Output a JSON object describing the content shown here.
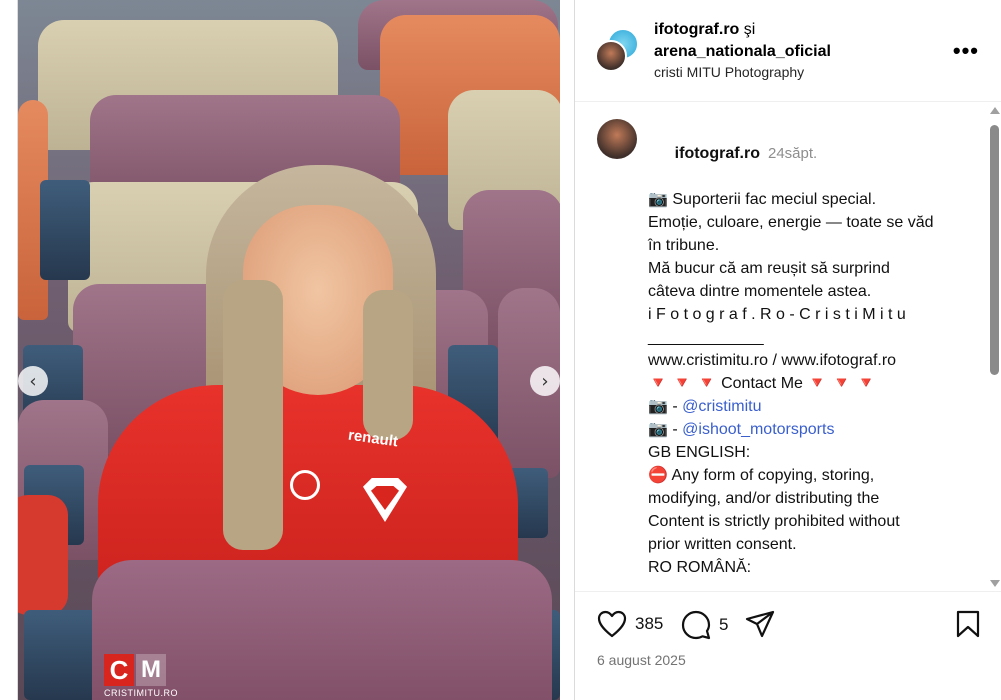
{
  "header": {
    "user1": "ifotograf.ro",
    "connector": "şi",
    "user2": "arena_nationala_oficial",
    "subtitle": "cristi MITU Photography",
    "more_label": "•••"
  },
  "media": {
    "shirt_brand": "renault",
    "watermark_text": "CRISTIMITU.RO",
    "prev_label": "‹",
    "next_label": "›"
  },
  "comment": {
    "username": "ifotograf.ro",
    "time": "24săpt.",
    "lines": [
      "📷 Suporterii fac meciul special.",
      "Emoție, culoare, energie — toate se văd",
      "în tribune.",
      "Mă bucur că am reușit să surprind",
      "câteva dintre momentele astea.",
      "",
      "i F o t o g r a f . R o - C r i s t i M i t u",
      "_____________",
      "www.cristimitu.ro / www.ifotograf.ro",
      "🔻 🔻 🔻 Contact Me 🔻 🔻 🔻",
      "📷 - ",
      "📷 - ",
      "",
      "GB ENGLISH:",
      "⛔ Any form of copying, storing,",
      "modifying, and/or distributing the",
      "Content is strictly prohibited without",
      "prior written consent.",
      "",
      "RO ROMÂNĂ:"
    ],
    "mention1": "@cristimitu",
    "mention2": "@ishoot_motorsports"
  },
  "actions": {
    "likes": "385",
    "comments": "5",
    "date": "6 august 2025"
  },
  "colors": {
    "link": "#3a5fcd",
    "muted": "#8e8e8e",
    "shirt_red": "#e8322b"
  }
}
